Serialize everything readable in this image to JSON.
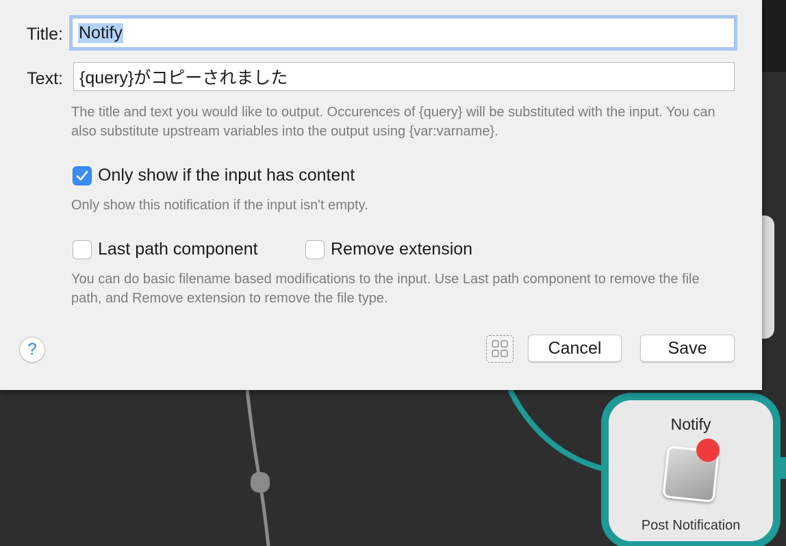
{
  "dialog": {
    "title_label": "Title:",
    "title_value": "Notify",
    "text_label": "Text:",
    "text_value": "{query}がコピーされました",
    "help_text": "The title and text you would like to output. Occurences of {query} will be substituted with the input. You can also substitute upstream variables into the output using {var:varname}.",
    "only_show_label": "Only show if the input has content",
    "only_show_checked": true,
    "only_show_help": "Only show this notification if the input isn't empty.",
    "last_path_label": "Last path component",
    "last_path_checked": false,
    "remove_ext_label": "Remove extension",
    "remove_ext_checked": false,
    "filename_help": "You can do basic filename based modifications to the input. Use Last path component to remove the file path, and Remove extension to remove the file type.",
    "help_button_glyph": "?",
    "cancel_label": "Cancel",
    "save_label": "Save"
  },
  "canvas": {
    "node": {
      "title": "Notify",
      "subtitle": "Post Notification",
      "icon": "notification-icon",
      "connection_color": "#1e9a98",
      "badge_color": "#ef3b3b"
    }
  },
  "colors": {
    "accent": "#3b8cf5",
    "focus_ring": "#a9c7f3",
    "selection": "#b3d3f9",
    "canvas_background": "#2e2e2e"
  }
}
